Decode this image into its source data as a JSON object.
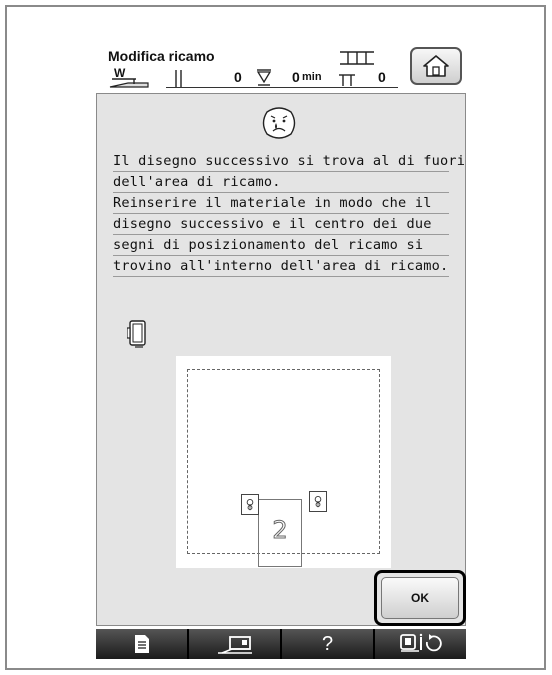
{
  "header": {
    "title": "Modifica ricamo",
    "presser_letter": "W",
    "stitch_count": "0",
    "time_value": "0",
    "time_unit": "min",
    "total_value": "0"
  },
  "message": {
    "lines": [
      "Il disegno successivo si trova al di fuori",
      "dell'area di ricamo.",
      "Reinserire il materiale in modo che il",
      "disegno successivo e il centro dei due",
      "segni di posizionamento del ricamo si",
      "trovino all'interno dell'area di ricamo."
    ]
  },
  "preview": {
    "design_number": "2"
  },
  "ok_button": {
    "label": "OK"
  },
  "bottom_bar": {
    "help_label": "?"
  },
  "icons": [
    "frame-icon",
    "home-icon",
    "presser-foot-icon",
    "thread-spool-icon",
    "bobbin-icon",
    "sad-face-icon",
    "embroidery-hoop-icon",
    "position-mark-icon",
    "document-icon",
    "machine-icon",
    "camera-settings-icon"
  ]
}
